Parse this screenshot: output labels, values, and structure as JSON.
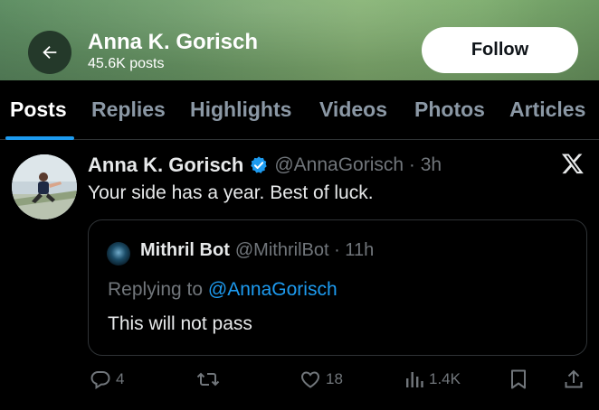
{
  "header": {
    "name": "Anna K. Gorisch",
    "post_count": "45.6K posts",
    "follow_label": "Follow"
  },
  "tabs": [
    {
      "label": "Posts",
      "active": true
    },
    {
      "label": "Replies"
    },
    {
      "label": "Highlights"
    },
    {
      "label": "Videos"
    },
    {
      "label": "Photos"
    },
    {
      "label": "Articles"
    }
  ],
  "post": {
    "author_name": "Anna K. Gorisch",
    "handle_time": "@AnnaGorisch · 3h",
    "text": "Your side has a year. Best of luck.",
    "quote": {
      "author_name": "Mithril Bot",
      "handle_time": "@MithrilBot · 11h",
      "replying_prefix": "Replying to ",
      "replying_handle": "@AnnaGorisch",
      "text": "This will not pass"
    },
    "actions": {
      "replies": "4",
      "reposts": "",
      "likes": "18",
      "views": "1.4K"
    }
  },
  "icons": [
    "back-arrow-icon",
    "verified-badge-icon",
    "x-logo-icon",
    "reply-icon",
    "repost-icon",
    "like-icon",
    "views-icon",
    "bookmark-icon",
    "share-icon"
  ],
  "colors": {
    "accent": "#1d9bf0",
    "muted": "#71767b",
    "background": "#000000"
  }
}
